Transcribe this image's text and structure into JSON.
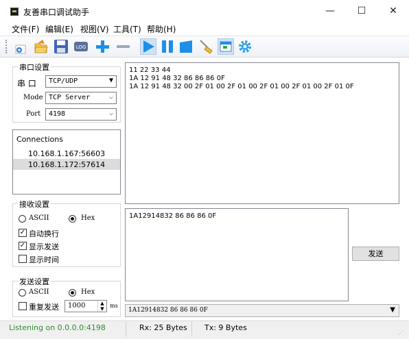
{
  "window": {
    "title": "友善串口调试助手",
    "minimize": "—",
    "maximize": "☐",
    "close": "✕"
  },
  "menu": [
    "文件(F)",
    "编辑(E)",
    "视图(V)",
    "工具(T)",
    "帮助(H)"
  ],
  "toolbar_icons": [
    "new-icon",
    "open-icon",
    "save-icon",
    "log-icon",
    "add-icon",
    "remove-icon",
    "play-icon",
    "pause-icon",
    "stop-icon",
    "clear-icon",
    "window-icon",
    "settings-icon"
  ],
  "serial_settings": {
    "title": "串口设置",
    "port_label": "串 口",
    "port_value": "TCP/UDP",
    "mode_label": "Mode",
    "mode_value": "TCP Server",
    "port_num_label": "Port",
    "port_num_value": "4198"
  },
  "connections": {
    "title": "Connections",
    "items": [
      "10.168.1.167:56603",
      "10.168.1.172:57614"
    ]
  },
  "receive_settings": {
    "title": "接收设置",
    "ascii_label": "ASCII",
    "hex_label": "Hex",
    "auto_wrap": "自动换行",
    "show_send": "显示发送",
    "show_time": "显示时间"
  },
  "send_settings": {
    "title": "发送设置",
    "ascii_label": "ASCII",
    "hex_label": "Hex",
    "repeat_label": "重复发送",
    "repeat_value": "1000",
    "unit": "ms"
  },
  "receive_area": {
    "lines": [
      "11 22 33 44",
      "1A 12 91 48 32 86 86 86 0F",
      "1A 12 91 48 32 00 2F 01 00 2F 01 00 2F 01 00 2F 01 00 2F 01 0F"
    ]
  },
  "send_area": {
    "text": "1A12914832 86 86 86 0F",
    "send_button": "发送",
    "history_value": "1A12914832 86 86 86 0F"
  },
  "status": {
    "listening": "Listening on 0.0.0.0:4198",
    "rx": "Rx: 25 Bytes",
    "tx": "Tx: 9 Bytes"
  },
  "colors": {
    "status_green": "#2e8b2e",
    "selection": "#dcdcdc",
    "toolbar_blue": "#1e8fe6"
  }
}
